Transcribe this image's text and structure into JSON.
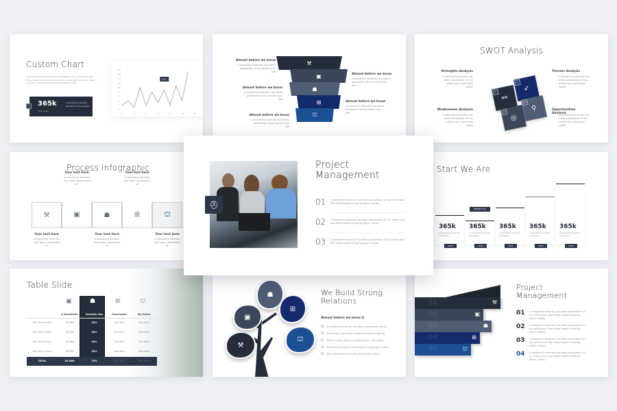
{
  "colors": {
    "background": "#eef0f4",
    "dark": "#252d3b",
    "slate": "#3b4658",
    "steel": "#4f5d75",
    "navy": "#142a6b",
    "blue": "#1c4f93"
  },
  "body_text": "A wonderful serenity has taken possession of my entire soul, like these sweet of spring which I enjoy",
  "custom_chart": {
    "title": "Custom Chart",
    "description": "A wonderful serenity has taken possession of my entire soul, like these sweet mornings of spring which I enjoy with my whole heart. I am alone, and feel the charm of existence in this",
    "stat_value": "365k",
    "stat_label": "Total Sales",
    "stat_text": "A wonderful serenity has taken of my entire",
    "stat_icon": "chart-icon",
    "chart_data": {
      "type": "line",
      "x": [
        0,
        1,
        2,
        3,
        4,
        5,
        6,
        7,
        8,
        9,
        10,
        11
      ],
      "values": [
        2,
        4,
        1,
        10,
        2,
        8,
        3,
        9,
        2,
        11,
        4,
        17
      ],
      "xticks": [
        "0",
        "2",
        "4",
        "6",
        "8",
        "10",
        "12"
      ],
      "yticks": [
        "0",
        "2",
        "4",
        "6",
        "8",
        "10",
        "12",
        "14",
        "16",
        "18"
      ],
      "ylim": [
        0,
        18
      ],
      "xlim": [
        0,
        12
      ],
      "tooltip": "2021",
      "tooltip_index": 7,
      "grid": false
    }
  },
  "funnel": {
    "left_labels": [
      {
        "title": "Almost before we know",
        "text": "A wonderful serenity has taken possession of my entire soul, like"
      },
      {
        "title": "Almost before we know",
        "text": "A wonderful serenity has taken possession of my entire soul, like"
      },
      {
        "title": "Almost before we know",
        "text": "A wonderful serenity has taken possession of my entire soul, like"
      }
    ],
    "right_labels": [
      {
        "title": "Almost before we know",
        "text": "A wonderful serenity has taken possession of my entire soul, like"
      },
      {
        "title": "Almost before we know",
        "text": "A wonderful serenity has taken possession of my entire soul, like"
      }
    ],
    "layers": [
      {
        "icon": "hammer-icon",
        "glyph": "⚒",
        "color": "#252d3b"
      },
      {
        "icon": "toolbox-icon",
        "glyph": "▣",
        "color": "#3b4658"
      },
      {
        "icon": "worker-icon",
        "glyph": "☗",
        "color": "#4f5d75"
      },
      {
        "icon": "barrier-icon",
        "glyph": "⊞",
        "color": "#142a6b"
      },
      {
        "icon": "crane-icon",
        "glyph": "⛫",
        "color": "#1c4f93"
      }
    ]
  },
  "swot": {
    "title": "SWOT Analysis",
    "items": [
      {
        "title": "Strengths Analysis",
        "text": "A wonderful serenity has taken possession of my entire soul, like these sweet",
        "num": "01",
        "icon": "dumbbell-icon",
        "glyph": "⚯",
        "color": "#252d3b"
      },
      {
        "title": "Threats Analysis",
        "text": "A wonderful serenity has taken possession of my entire soul, like these sweet",
        "num": "02",
        "icon": "rocket-icon",
        "glyph": "➶",
        "color": "#142a6b"
      },
      {
        "title": "Weaknesses Analysis",
        "text": "A wonderful serenity has taken possession of my entire soul, like these sweet",
        "num": "03",
        "icon": "target-icon",
        "glyph": "◎",
        "color": "#3b4658"
      },
      {
        "title": "Opportunities Analysis",
        "text": "A wonderful serenity has taken possession of my entire soul, like these sweet",
        "num": "04",
        "icon": "search-icon",
        "glyph": "⚲",
        "color": "#4f5d75"
      }
    ]
  },
  "process": {
    "title": "Process Infographic",
    "steps": [
      {
        "title": "Your text here",
        "text": "A wonderful serenity has taken possession of",
        "icon": "hammer-icon",
        "glyph": "⚒"
      },
      {
        "title": "Your text here",
        "text": "A wonderful serenity has taken possession of",
        "icon": "toolbox-icon",
        "glyph": "▣"
      },
      {
        "title": "Your text here",
        "text": "A wonderful serenity has taken possession of",
        "icon": "worker-icon",
        "glyph": "☗"
      },
      {
        "title": "Your text here",
        "text": "A wonderful serenity has taken possession of",
        "icon": "barrier-icon",
        "glyph": "⊞"
      },
      {
        "title": "Your text here",
        "text": "A wonderful serenity has taken possession of",
        "icon": "crane-icon",
        "glyph": "⛫"
      }
    ]
  },
  "feature": {
    "title_line1": "Project",
    "title_line2": "Management",
    "badge_icon": "helmet-icon",
    "items": [
      {
        "num": "01",
        "text": "A wonderful serenity has taken possession of my entire soul, like these sweet of spring which I enjoy"
      },
      {
        "num": "02",
        "text": "A wonderful serenity has taken possession of my entire soul, like these sweet of spring which I enjoy"
      },
      {
        "num": "03",
        "text": "A wonderful serenity has taken possession of my entire soul, like these sweet of spring which I enjoy"
      }
    ]
  },
  "start": {
    "title": "Start We Are",
    "tooltip": "PROJECT 01",
    "bars": [
      {
        "value": "365k",
        "text": "A wonderful serenity has taken",
        "year": "2019",
        "level": 1
      },
      {
        "value": "365k",
        "text": "A wonderful serenity has taken",
        "year": "2020",
        "level": 0.8
      },
      {
        "value": "365k",
        "text": "A wonderful serenity has taken",
        "year": "2021",
        "level": 1.3
      },
      {
        "value": "365k",
        "text": "A wonderful serenity has taken",
        "year": "2022",
        "level": 1.7
      },
      {
        "value": "365k",
        "text": "A wonderful serenity has taken",
        "year": "2023",
        "level": 2.2
      }
    ]
  },
  "table": {
    "title": "Table Slide",
    "header_icons": [
      "toolbox-icon",
      "worker-icon",
      "barrier-icon",
      "crane-icon"
    ],
    "columns": [
      "",
      "A Wonderful",
      "Serenity Has",
      "Possession",
      "My Entire"
    ],
    "rows": [
      [
        "Your Text in Here",
        "36.5Mb",
        "25%",
        "Text Here",
        "Text Here"
      ],
      [
        "Your Text in Here",
        "36.5Mb",
        "50%",
        "Text Here",
        "Text Here"
      ],
      [
        "Your Text in Here",
        "36.5Mb",
        "40%",
        "Text Here",
        "Text Here"
      ],
      [
        "Your Text in Here",
        "36.5Mb",
        "95%",
        "Text Here",
        "Text Here"
      ]
    ],
    "total": [
      "TOTAL",
      "36.5Mb",
      "75%",
      "Text Here",
      "Text Here"
    ]
  },
  "tree": {
    "title_line1": "We Build Strong",
    "title_line2": "Relations",
    "subtitle": "Almost before we knew it",
    "checklist": [
      "A wonderful serenity has taken possession of my",
      "Entire soul, like these sweet mornings of spring",
      "Which I enjoy with my whole heart. I am alone",
      "And feel the charm of existence in this spot, which",
      "Was created for the bliss of souls like mine"
    ],
    "leaves": [
      {
        "icon": "hammer-icon",
        "glyph": "⚒",
        "color": "#252d3b"
      },
      {
        "icon": "toolbox-icon",
        "glyph": "▣",
        "color": "#3b4658"
      },
      {
        "icon": "worker-icon",
        "glyph": "☗",
        "color": "#4f5d75"
      },
      {
        "icon": "barrier-icon",
        "glyph": "⊞",
        "color": "#142a6b"
      },
      {
        "icon": "crane-icon",
        "glyph": "⛫",
        "color": "#1c4f93"
      }
    ]
  },
  "steps": {
    "title_line1": "Project",
    "title_line2": "Management",
    "layers": [
      {
        "num": "01",
        "icon": "hammer-icon",
        "glyph": "⚒",
        "color": "#252d3b"
      },
      {
        "num": "02",
        "icon": "toolbox-icon",
        "glyph": "▣",
        "color": "#3b4658"
      },
      {
        "num": "03",
        "icon": "worker-icon",
        "glyph": "☗",
        "color": "#4f5d75"
      },
      {
        "num": "04",
        "icon": "barrier-icon",
        "glyph": "⊞",
        "color": "#142a6b"
      },
      {
        "num": "05",
        "icon": "crane-icon",
        "glyph": "⛫",
        "color": "#1c4f93"
      }
    ],
    "items": [
      {
        "num": "01",
        "text": "A wonderful serenity has taken possession of my entire soul, like these sweet of spring which I enjoy"
      },
      {
        "num": "02",
        "text": "A wonderful serenity has taken possession of my entire soul, like these sweet of spring which I enjoy"
      },
      {
        "num": "03",
        "text": "A wonderful serenity has taken possession of my entire soul, like these sweet of spring which I enjoy"
      },
      {
        "num": "04",
        "text": "A wonderful serenity has taken possession of my entire soul, like these sweet of spring which I enjoy"
      }
    ]
  }
}
